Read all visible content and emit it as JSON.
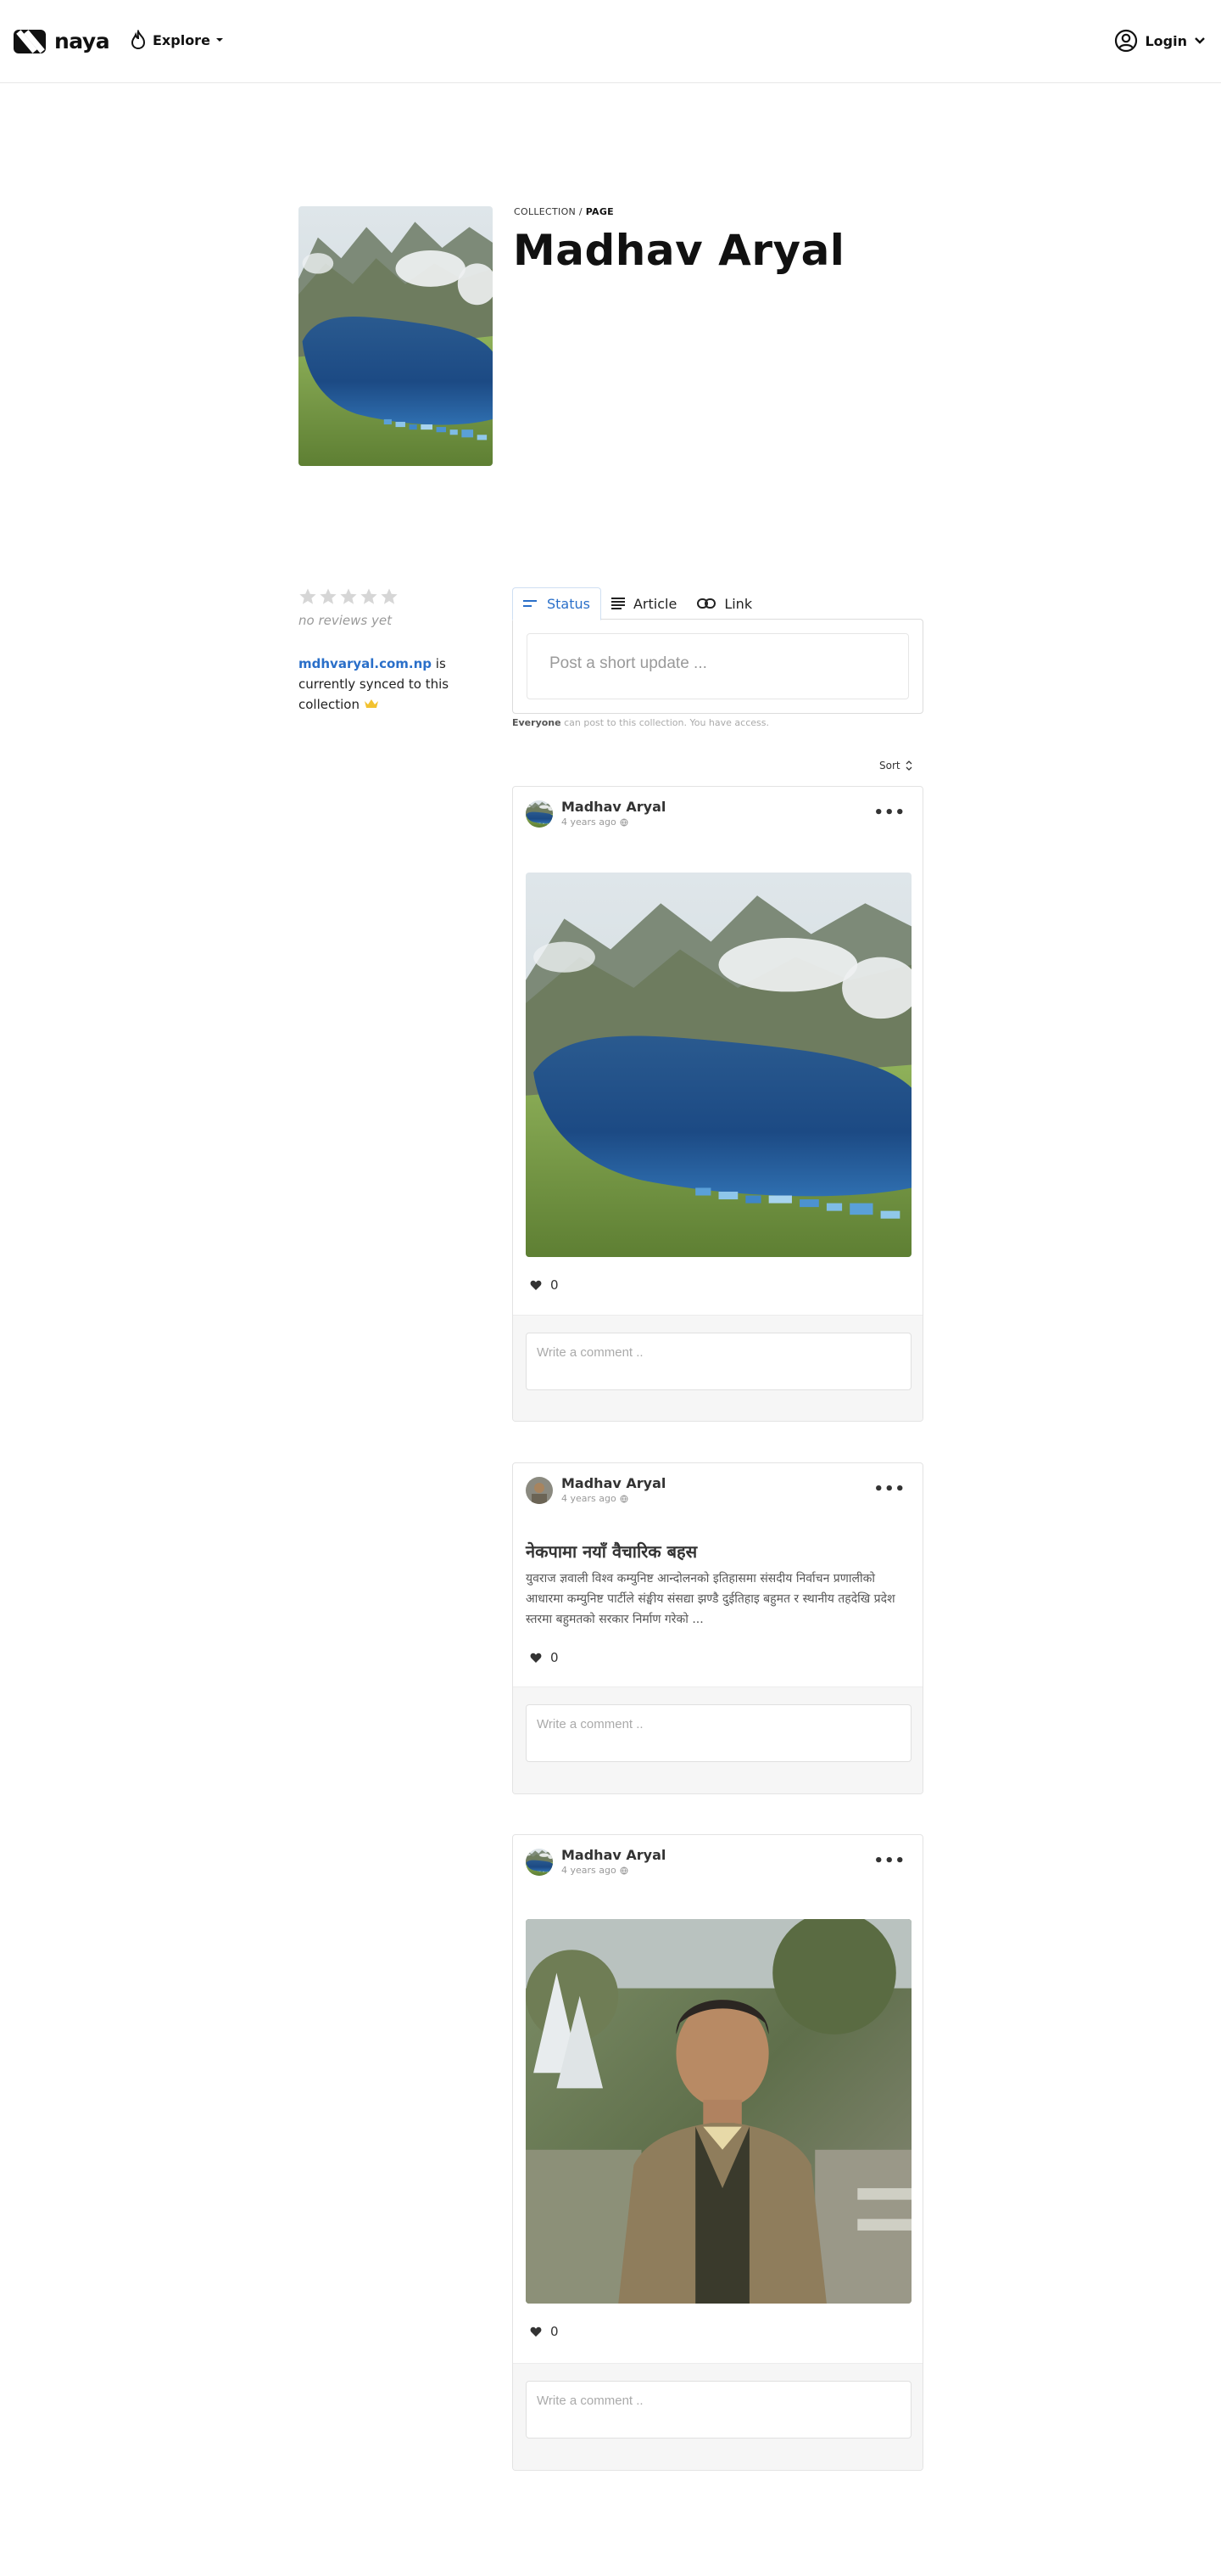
{
  "header": {
    "brand": "naya",
    "explore_label": "Explore",
    "login_label": "Login"
  },
  "collection": {
    "breadcrumb_prefix": "COLLECTION /",
    "breadcrumb_current": "PAGE",
    "title": "Madhav Aryal"
  },
  "sidebar": {
    "rating_stars": 5,
    "no_reviews": "no reviews yet",
    "sync_link": "mdhvaryal.com.np",
    "sync_text": " is currently synced to this collection"
  },
  "composer": {
    "tabs": [
      {
        "label": "Status",
        "icon": "status-lines-icon",
        "active": true
      },
      {
        "label": "Article",
        "icon": "article-lines-icon",
        "active": false
      },
      {
        "label": "Link",
        "icon": "link-icon",
        "active": false
      }
    ],
    "placeholder": "Post a short update ...",
    "access_who": "Everyone",
    "access_text": " can post to this collection. You have access."
  },
  "sort_label": "Sort",
  "posts": [
    {
      "author": "Madhav Aryal",
      "time": "4 years ago",
      "type": "image",
      "image": "mountain-lake-photo",
      "likes": "0",
      "comment_placeholder": "Write a comment .."
    },
    {
      "author": "Madhav Aryal",
      "time": "4 years ago",
      "type": "article",
      "title": "नेकपामा नयाँ वैचारिक बहस",
      "excerpt": "युवराज ज्ञवाली विश्व कम्युनिष्ट आन्दोलनको इतिहासमा संसदीय निर्वाचन प्रणालीको आधारमा कम्युनिष्ट पार्टीले संङ्घीय संसद्या झण्डै दुईतिहाइ बहुमत र स्थानीय तहदेखि प्रदेश स्तरमा बहुमतको सरकार निर्माण गरेको ...",
      "likes": "0",
      "comment_placeholder": "Write a comment .."
    },
    {
      "author": "Madhav Aryal",
      "time": "4 years ago",
      "type": "image",
      "image": "portrait-photo",
      "likes": "0",
      "comment_placeholder": "Write a comment .."
    }
  ],
  "colors": {
    "accent_blue": "#2a6fc9",
    "star_grey": "#d6d6d6",
    "crown_yellow": "#f2c230"
  }
}
